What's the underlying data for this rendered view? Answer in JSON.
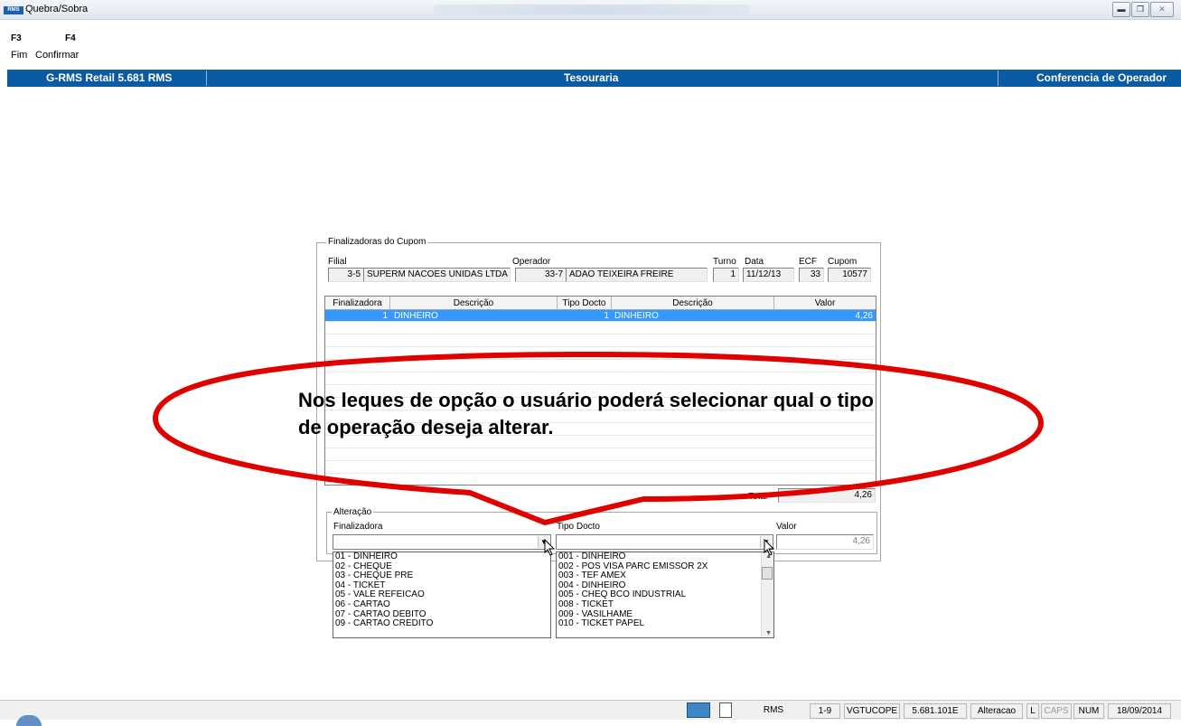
{
  "window": {
    "title": "Quebra/Sobra",
    "app_icon": "RMS",
    "controls": [
      "minimize-icon",
      "restore-icon",
      "close-icon"
    ]
  },
  "toolbar": {
    "buttons": [
      {
        "key": "F3",
        "label": "Fim"
      },
      {
        "key": "F4",
        "label": "Confirmar"
      }
    ]
  },
  "header_bar": {
    "left": "G-RMS Retail 5.681 RMS",
    "center": "Tesouraria",
    "right": "Conferencia de Operador"
  },
  "cupom": {
    "group_title": "Finalizadoras do Cupom",
    "labels": {
      "filial": "Filial",
      "operador": "Operador",
      "turno": "Turno",
      "data": "Data",
      "ecf": "ECF",
      "cupom": "Cupom"
    },
    "filial_code": "3-5",
    "filial_name": "SUPERM NACOES UNIDAS LTDA",
    "operador_code": "33-7",
    "operador_name": "ADAO TEIXEIRA FREIRE",
    "turno": "1",
    "data": "11/12/13",
    "ecf": "33",
    "cupom": "10577"
  },
  "grid": {
    "columns": [
      "Finalizadora",
      "Descrição",
      "Tipo Docto",
      "Descrição",
      "Valor"
    ],
    "rows": [
      {
        "finalizadora": "1",
        "descricao": "DINHEIRO",
        "tipo_docto": "1",
        "descricao2": "DINHEIRO",
        "valor": "4,26"
      }
    ],
    "total_label": "Total",
    "total_value": "4,26"
  },
  "alteracao": {
    "group_title": "Alteração",
    "labels": {
      "finalizadora": "Finalizadora",
      "tipo_docto": "Tipo Docto",
      "valor": "Valor"
    },
    "valor": "4,26",
    "finalizadora_options": [
      "01 - DINHEIRO",
      "02 - CHEQUE",
      "03 - CHEQUE PRE",
      "04 - TICKET",
      "05 - VALE REFEICAO",
      "06 - CARTAO",
      "07 - CARTAO DEBITO",
      "09 - CARTAO CREDITO"
    ],
    "tipo_docto_options": [
      "001 - DINHEIRO",
      "002 - POS VISA PARC EMISSOR  2X",
      "003 - TEF AMEX",
      "004 - DINHEIRO",
      "005 - CHEQ BCO INDUSTRIAL",
      "008 - TICKET",
      "009 - VASILHAME",
      "010 - TICKET PAPEL"
    ]
  },
  "annotation": {
    "text": "Nos leques de opção o usuário poderá selecionar qual o tipo de operação deseja alterar.",
    "color": "#e00000"
  },
  "statusbar": {
    "rms": "RMS",
    "range": "1-9",
    "program": "VGTUCOPE",
    "version": "5.681.101E",
    "mode": "Alteracao",
    "l": "L",
    "caps": "CAPS",
    "num": "NUM",
    "date": "18/09/2014"
  }
}
